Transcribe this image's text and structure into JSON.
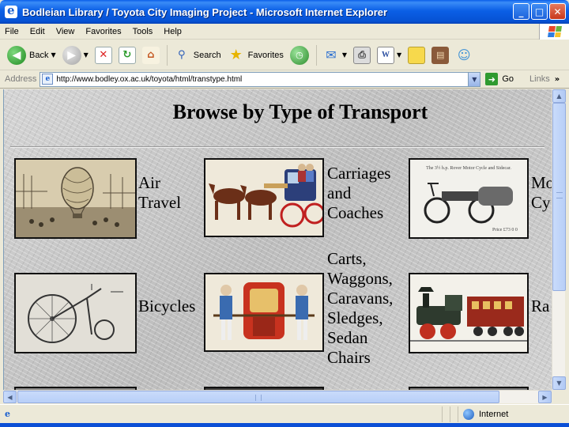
{
  "window": {
    "title": "Bodleian Library / Toyota City Imaging Project - Microsoft Internet Explorer",
    "buttons": {
      "minimize": "_",
      "maximize": "□",
      "close": "✕"
    }
  },
  "menu": [
    "File",
    "Edit",
    "View",
    "Favorites",
    "Tools",
    "Help"
  ],
  "toolbar": {
    "back_label": "Back",
    "search_label": "Search",
    "favorites_label": "Favorites",
    "icons": [
      "back-icon",
      "forward-icon",
      "stop-icon",
      "refresh-icon",
      "home-icon",
      "search-icon",
      "favorites-icon",
      "history-icon",
      "mail-icon",
      "print-icon",
      "edit-icon",
      "discuss-icon",
      "research-icon",
      "messenger-icon"
    ]
  },
  "address": {
    "label": "Address",
    "url": "http://www.bodley.ox.ac.uk/toyota/html/transtype.html",
    "go_label": "Go",
    "links_label": "Links"
  },
  "page": {
    "title": "Browse by Type of Transport",
    "categories": [
      {
        "label": "Air Travel",
        "lines": [
          "Air",
          "Travel"
        ]
      },
      {
        "label": "Carriages and Coaches",
        "lines": [
          "Carriages",
          "and",
          "Coaches"
        ]
      },
      {
        "label": "Motor Cycles (partially visible)",
        "lines": [
          "Mo",
          "Cy"
        ]
      },
      {
        "label": "Bicycles",
        "lines": [
          "Bicycles"
        ]
      },
      {
        "label": "Carts, Waggons, Caravans, Sledges, Sedan Chairs",
        "lines": [
          "Carts,",
          "Waggons,",
          "Caravans,",
          "Sledges,",
          "Sedan",
          "Chairs"
        ]
      },
      {
        "label": "Railways (partially visible)",
        "lines": [
          "Ra"
        ]
      }
    ],
    "image_caption_3": "The 3½ h.p. Rover Motor Cycle and Sidecar.",
    "image_price_3": "Price   £73  0  0"
  },
  "status": {
    "zone": "Internet"
  }
}
